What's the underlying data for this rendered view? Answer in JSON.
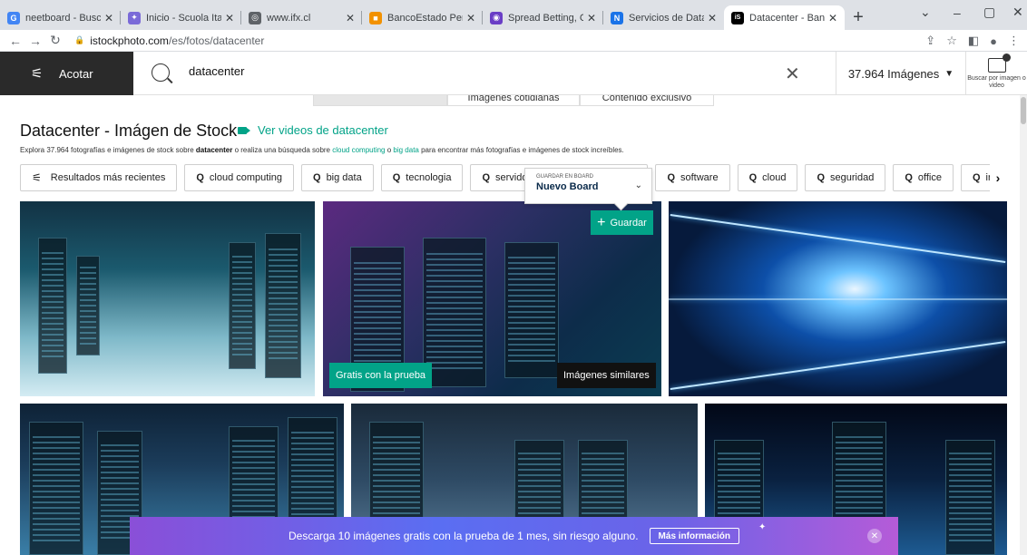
{
  "browser": {
    "tabs": [
      {
        "title": "neetboard - Buscar co",
        "fav": "G",
        "color": "#4285f4"
      },
      {
        "title": "Inicio - Scuola Italiana",
        "fav": "✦",
        "color": "#7a6ad8"
      },
      {
        "title": "www.ifx.cl",
        "fav": "◎",
        "color": "#5f6368"
      },
      {
        "title": "BancoEstado Persona",
        "fav": "■",
        "color": "#f29100"
      },
      {
        "title": "Spread Betting, CFD &",
        "fav": "◉",
        "color": "#6a3ec6"
      },
      {
        "title": "Servicios de Datacent",
        "fav": "N",
        "color": "#1a73e8"
      },
      {
        "title": "Datacenter - Banco d",
        "fav": "iS",
        "color": "#000000"
      }
    ],
    "active_tab": 6,
    "url_host": "istockphoto.com",
    "url_path": "/es/fotos/datacenter"
  },
  "header": {
    "refine_label": "Acotar",
    "search_value": "datacenter",
    "count_label": "37.964 Imágenes",
    "image_search_label": "Buscar por imagen o video"
  },
  "subtabs": [
    "",
    "Imágenes cotidianas",
    "Contenido exclusivo"
  ],
  "title": "Datacenter - Imágen de Stock",
  "video_link": "Ver videos de datacenter",
  "intro": {
    "part1": "Explora 37.964 fotografías e imágenes de stock sobre ",
    "term": "datacenter",
    "part2": " o realiza una búsqueda sobre ",
    "link1": "cloud computing",
    "part3": " o ",
    "link2": "big data",
    "part4": " para encontrar más fotografías e imágenes de stock increíbles."
  },
  "chips": {
    "recent": "Resultados más recientes",
    "items": [
      "cloud computing",
      "big data",
      "tecnologia",
      "servido",
      "software",
      "cloud",
      "seguridad",
      "office",
      "inte"
    ]
  },
  "board": {
    "label": "GUARDAR EN BOARD",
    "value": "Nuevo Board"
  },
  "save_label": "Guardar",
  "free_label": "Gratis con la prueba",
  "similar_label": "Imágenes similares",
  "promo": {
    "message": "Descarga 10 imágenes gratis con la prueba de 1 mes, sin riesgo alguno.",
    "more": "Más información"
  },
  "colors": {
    "accent": "#02a388",
    "header_dark": "#2a2a2a"
  }
}
